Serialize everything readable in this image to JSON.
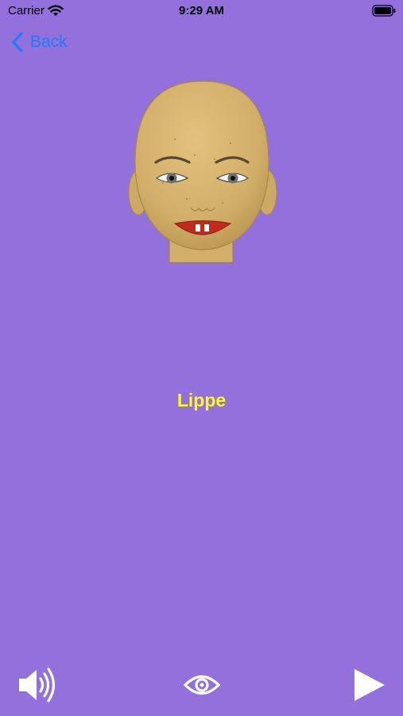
{
  "status_bar": {
    "carrier": "Carrier",
    "time": "9:29 AM"
  },
  "nav": {
    "back_label": "Back"
  },
  "card": {
    "word": "Lippe",
    "image_icon": "face-icon"
  },
  "controls": {
    "speaker_icon": "speaker-icon",
    "eye_icon": "eye-icon",
    "play_icon": "play-icon"
  },
  "colors": {
    "background": "#9370DB",
    "accent": "#1E7CF7",
    "word": "#FFFF00"
  }
}
